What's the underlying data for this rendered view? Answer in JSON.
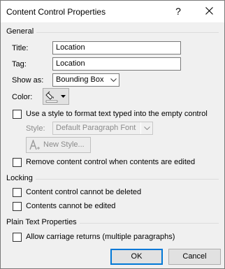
{
  "window": {
    "title": "Content Control Properties",
    "help_glyph": "?"
  },
  "general": {
    "section_label": "General",
    "title_label": "Title:",
    "title_value": "Location",
    "tag_label": "Tag:",
    "tag_value": "Location",
    "show_as_label": "Show as:",
    "show_as_value": "Bounding Box",
    "color_label": "Color:",
    "use_style_label": "Use a style to format text typed into the empty control",
    "use_style_checked": false,
    "style_label": "Style:",
    "style_value": "Default Paragraph Font",
    "new_style_label": "New Style...",
    "remove_label": "Remove content control when contents are edited",
    "remove_checked": false
  },
  "locking": {
    "section_label": "Locking",
    "cannot_delete_label": "Content control cannot be deleted",
    "cannot_delete_checked": false,
    "cannot_edit_label": "Contents cannot be edited",
    "cannot_edit_checked": false
  },
  "plain_text": {
    "section_label": "Plain Text Properties",
    "allow_returns_label": "Allow carriage returns (multiple paragraphs)",
    "allow_returns_checked": false
  },
  "buttons": {
    "ok": "OK",
    "cancel": "Cancel"
  },
  "colors": {
    "accent": "#0078d7",
    "disabled_text": "#8b8b8b"
  },
  "icons": [
    "close-icon",
    "paint-bucket-icon",
    "chevron-down-icon",
    "new-style-icon"
  ]
}
